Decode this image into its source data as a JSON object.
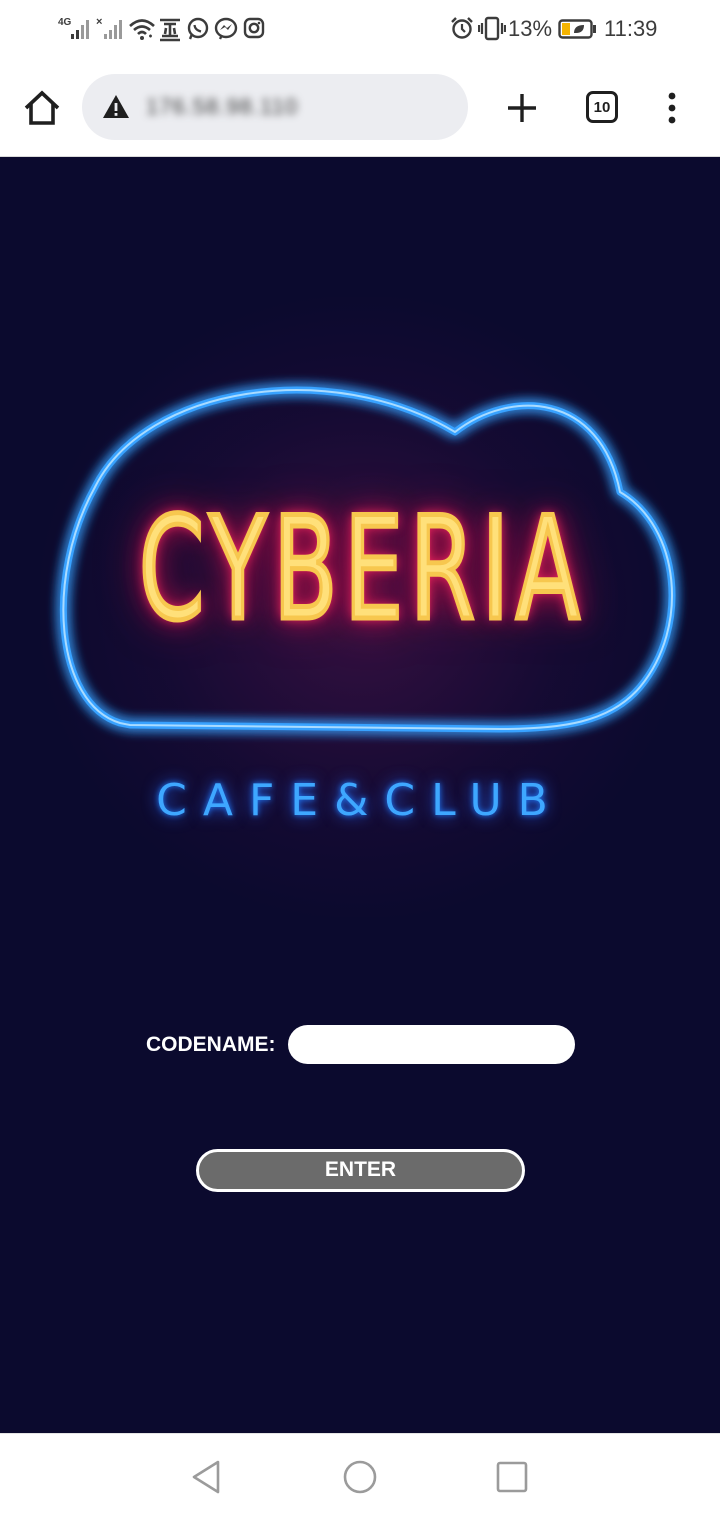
{
  "status_bar": {
    "signal_1_label": "4G",
    "battery_percent": "13%",
    "time": "11:39",
    "icons": [
      "signal-4g-icon",
      "signal-no-sim-icon",
      "wifi-icon",
      "news-app-icon",
      "whatsapp-icon",
      "messenger-icon",
      "instagram-icon",
      "alarm-icon",
      "vibrate-icon",
      "battery-saver-icon"
    ]
  },
  "toolbar": {
    "url": "176.58.98.110",
    "tab_count": "10",
    "icons": [
      "home-icon",
      "warning-icon",
      "plus-icon",
      "tab-switcher-icon",
      "more-vert-icon"
    ]
  },
  "logo": {
    "wordmark": "CYBERIA",
    "subtitle": "CAFE&CLUB",
    "colors": {
      "cloud_outline": "#39a2ff",
      "wordmark_fill": "#ffe07a",
      "wordmark_glow": "#ff2a64",
      "subtitle": "#3ea7ff"
    }
  },
  "form": {
    "codename_label": "CODENAME:",
    "codename_value": "",
    "enter_label": "ENTER"
  },
  "page": {
    "background": "#0b0a2e"
  },
  "nav_bar": {
    "icons": [
      "back-icon",
      "home-circle-icon",
      "recents-icon"
    ]
  }
}
